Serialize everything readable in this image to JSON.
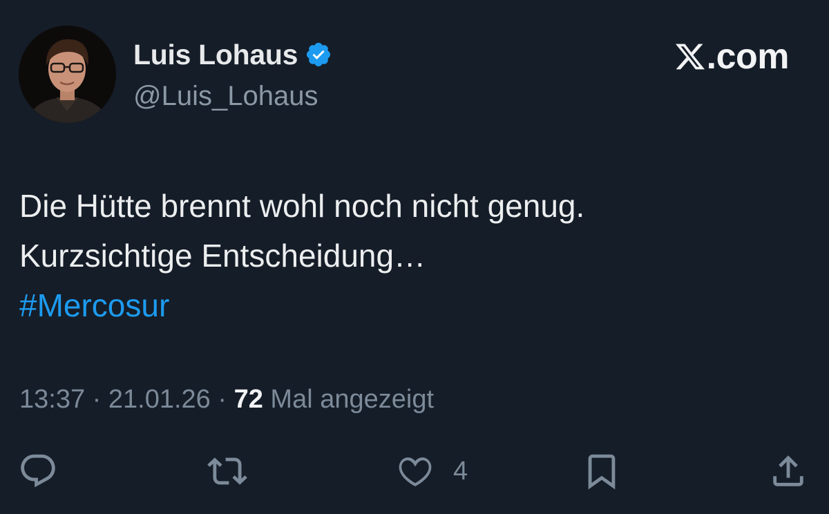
{
  "author": {
    "display_name": "Luis Lohaus",
    "handle": "@Luis_Lohaus",
    "verified_icon": "verified-badge-icon"
  },
  "brand": {
    "text": ".com",
    "icon": "x-logo-icon"
  },
  "tweet": {
    "lines": [
      "Die Hütte brennt wohl noch nicht genug.",
      "Kurzsichtige Entscheidung…"
    ],
    "hashtag": "#Mercosur"
  },
  "meta": {
    "time": "13:37",
    "separator": " · ",
    "date": "21.01.26",
    "views_count": "72",
    "views_label": " Mal angezeigt"
  },
  "actions": {
    "reply": {
      "icon": "reply-icon"
    },
    "repost": {
      "icon": "repost-icon"
    },
    "like": {
      "icon": "heart-icon",
      "count": "4"
    },
    "bookmark": {
      "icon": "bookmark-icon"
    },
    "share": {
      "icon": "share-icon"
    }
  },
  "colors": {
    "background": "#151d28",
    "text": "#e7e9ea",
    "secondary": "#7c8a99",
    "accent": "#1d9bf0"
  }
}
